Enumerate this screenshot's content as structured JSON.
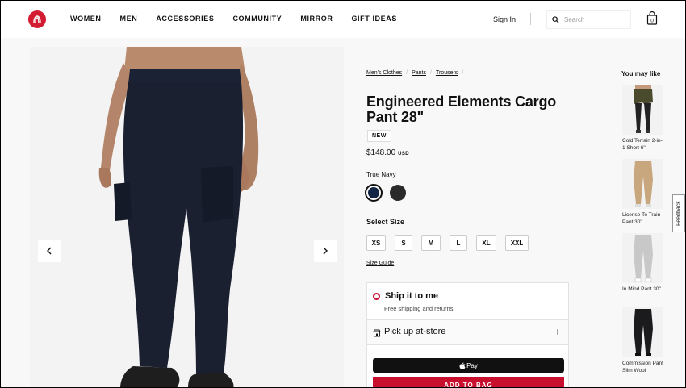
{
  "header": {
    "nav": [
      "WOMEN",
      "MEN",
      "ACCESSORIES",
      "COMMUNITY",
      "MIRROR",
      "GIFT IDEAS"
    ],
    "sign_in": "Sign In",
    "search_placeholder": "Search",
    "bag_count": "0"
  },
  "breadcrumb": [
    "Men's Clothes",
    "Pants",
    "Trousers"
  ],
  "product": {
    "title": "Engineered Elements Cargo Pant 28\"",
    "badge": "NEW",
    "price": "$148.00",
    "currency": "USD",
    "color_name": "True Navy",
    "swatches": [
      {
        "name": "True Navy",
        "color": "#122544"
      },
      {
        "name": "Black",
        "color": "#2a2a2a"
      }
    ],
    "size_label": "Select Size",
    "sizes": [
      "XS",
      "S",
      "M",
      "L",
      "XL",
      "XXL"
    ],
    "size_guide": "Size Guide"
  },
  "fulfillment": {
    "ship_title": "Ship it to me",
    "ship_sub": "Free shipping and returns",
    "pickup_title": "Pick up at-store",
    "apple_pay": "Pay",
    "add_to_bag": "ADD TO BAG"
  },
  "recommendations": {
    "title": "You may like",
    "items": [
      {
        "name": "Cold Terrain 2-in-1 Short 6\""
      },
      {
        "name": "License To Train Pant 30\""
      },
      {
        "name": "In Mind Pant 30\""
      },
      {
        "name": "Commission Pant Slim Wool"
      }
    ]
  },
  "feedback": "Feedback",
  "colors": {
    "brand": "#d31b32",
    "accent": "#c8102e"
  }
}
